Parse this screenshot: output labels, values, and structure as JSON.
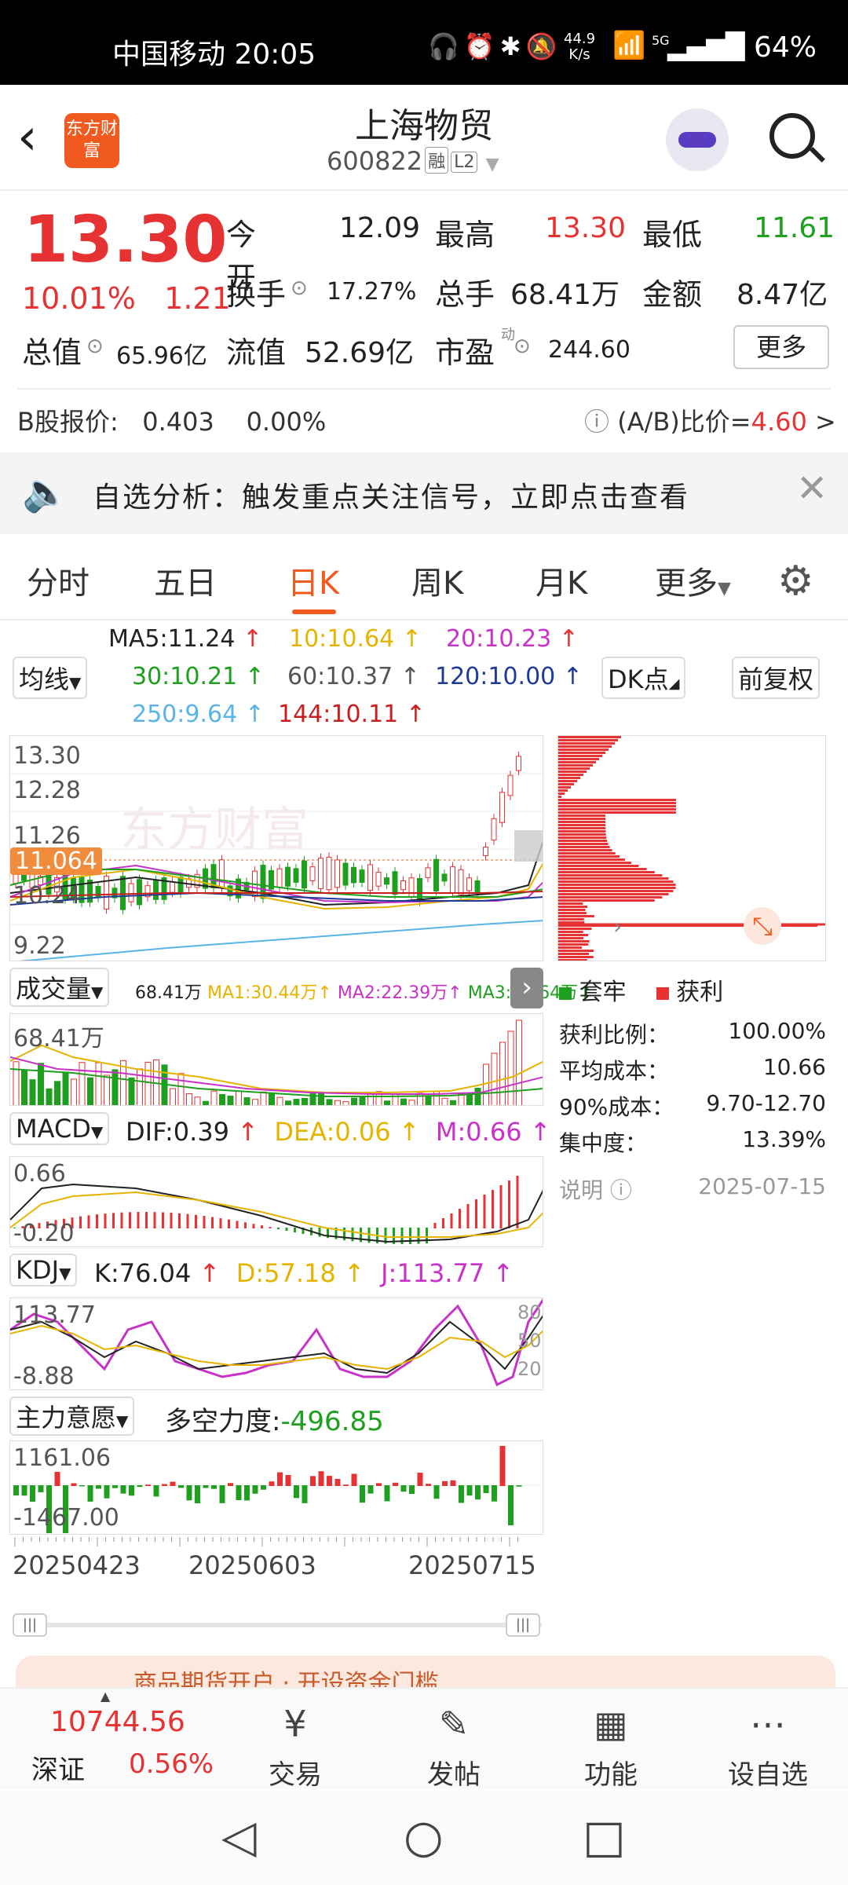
{
  "status": {
    "carrier_time": "中国移动 20:05",
    "speed_top": "44.9",
    "speed_unit": "K/s",
    "signal": "5G",
    "battery": "64%"
  },
  "header": {
    "logo": "东方财富",
    "name": "上海物贸",
    "code": "600822",
    "tag1": "融",
    "tag2": "L2"
  },
  "quote": {
    "price": "13.30",
    "change_pct": "10.01%",
    "change": "1.21",
    "open_label": "今开",
    "open": "12.09",
    "high_label": "最高",
    "high": "13.30",
    "low_label": "最低",
    "low": "11.61",
    "turnover_label": "换手",
    "turnover": "17.27%",
    "volume_label": "总手",
    "volume": "68.41万",
    "amount_label": "金额",
    "amount": "8.47亿",
    "mcap_label": "总值",
    "mcap": "65.96亿",
    "float_label": "流值",
    "float": "52.69亿",
    "pe_label": "市盈",
    "pe_sup": "动",
    "pe": "244.60",
    "more": "更多",
    "b_label": "B股报价:",
    "b_price": "0.403",
    "b_pct": "0.00%",
    "ab_label": "(A/B)比价=",
    "ab_value": "4.60",
    "ab_arrow": ">"
  },
  "alert": {
    "text": "自选分析：触发重点关注信号，立即点击查看"
  },
  "tabs": [
    "分时",
    "五日",
    "日K",
    "周K",
    "月K",
    "更多"
  ],
  "ma": {
    "select": "均线",
    "ma5": "MA5:11.24",
    "ma10": "10:10.64",
    "ma20": "20:10.23",
    "ma30": "30:10.21",
    "ma60": "60:10.37",
    "ma120": "120:10.00",
    "ma250": "250:9.64",
    "ma144": "144:10.11",
    "dk": "DK点",
    "fq": "前复权"
  },
  "kline": {
    "y_labels": [
      "13.30",
      "12.28",
      "11.26",
      "10.24",
      "9.22"
    ],
    "cursor": "11.064",
    "watermark": "东方财富"
  },
  "volume": {
    "select": "成交量",
    "v": "68.41万",
    "ma1": "MA1:30.44万",
    "ma2": "MA2:22.39万",
    "ma3": "MA3:13.64万",
    "axis": "68.41万"
  },
  "macd": {
    "select": "MACD",
    "dif": "DIF:0.39",
    "dea": "DEA:0.06",
    "m": "M:0.66",
    "top": "0.66",
    "bottom": "-0.20"
  },
  "kdj": {
    "select": "KDJ",
    "k": "K:76.04",
    "d": "D:57.18",
    "j": "J:113.77",
    "top": "113.77",
    "bottom": "-8.88",
    "r80": "80",
    "r50": "50",
    "r20": "20"
  },
  "zl": {
    "select": "主力意愿",
    "label": "多空力度:",
    "value": "-496.85",
    "top": "1161.06",
    "bottom": "-1467.00"
  },
  "dates": [
    "20250423",
    "20250603",
    "20250715"
  ],
  "chip": {
    "legend_trap": "套牢",
    "legend_profit": "获利",
    "rows": [
      {
        "k": "获利比例：",
        "v": "100.00%"
      },
      {
        "k": "平均成本：",
        "v": "10.66"
      },
      {
        "k": "90%成本：",
        "v": "9.70-12.70"
      },
      {
        "k": "集中度：",
        "v": "13.39%"
      }
    ],
    "note": "说明",
    "date": "2025-07-15"
  },
  "banner": {
    "text": "商品期货开户 · 开设资金门槛"
  },
  "bottom": {
    "index_value": "10744.56",
    "index_name": "深证",
    "index_pct": "0.56%",
    "items": [
      "交易",
      "发帖",
      "功能",
      "设自选"
    ]
  },
  "colors": {
    "up": "#e63232",
    "down": "#1ea01e",
    "accent": "#f05a1e"
  }
}
